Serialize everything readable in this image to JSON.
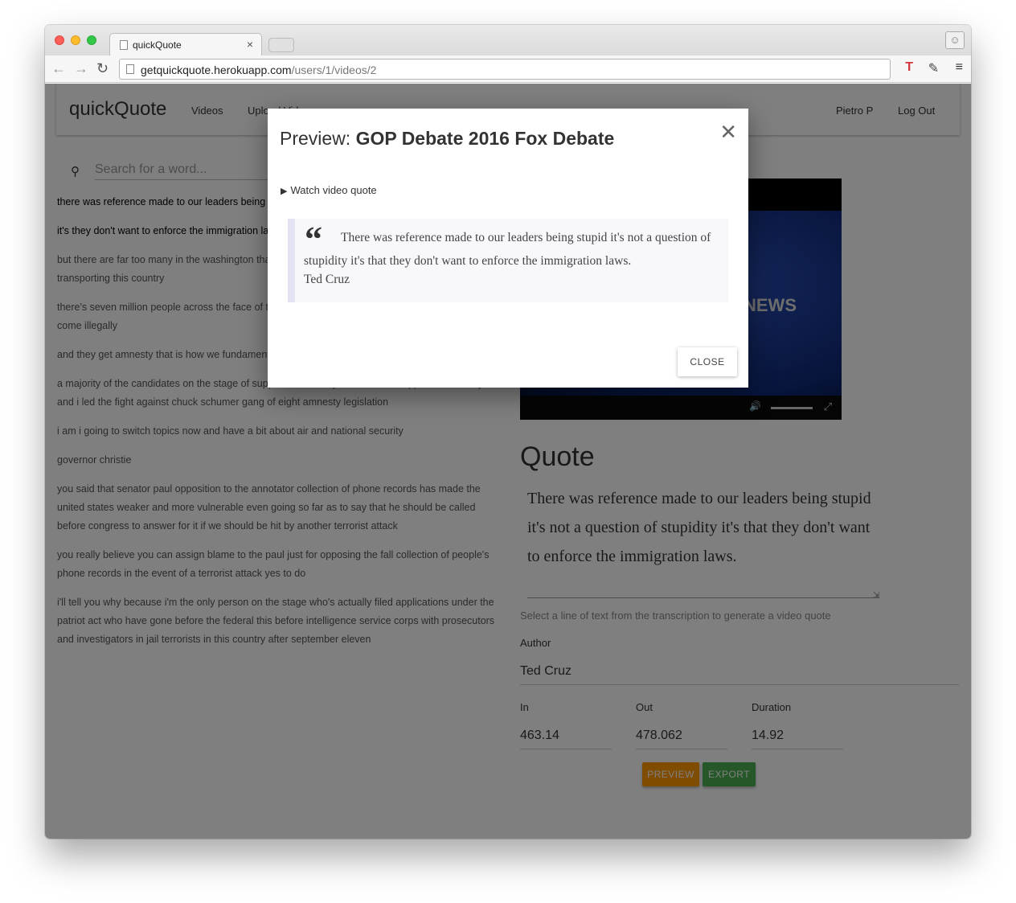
{
  "browser": {
    "tab_title": "quickQuote",
    "tab_close": "×",
    "url_domain": "getquickquote.herokuapp.com",
    "url_path": "/users/1/videos/2"
  },
  "app": {
    "brand": "quickQuote",
    "nav": {
      "videos": "Videos",
      "upload": "Upload Video",
      "user": "Pietro P",
      "logout": "Log Out"
    },
    "search_placeholder": "Search for a word..."
  },
  "transcript": [
    {
      "text": "there was reference made to our leaders being stupid it's not a question of stupidity",
      "highlighted": true
    },
    {
      "text": "it's they don't want to enforce the immigration laws",
      "highlighted": true
    },
    {
      "text": "but there are far too many in the washington that are not interested in talking about fundamentally transporting this country",
      "highlighted": false
    },
    {
      "text": "there's seven million people across the face of the country they come illegally great but if they come illegally",
      "highlighted": false
    },
    {
      "text": "and they get amnesty that is how we fundamentally transform this country it's striking",
      "highlighted": false
    },
    {
      "text": "a majority of the candidates on the stage of supported amnesty i have never supported amnesty and i led the fight against chuck schumer gang of eight amnesty legislation",
      "highlighted": false
    },
    {
      "text": "i am i going to switch topics now and have a bit about air and national security",
      "highlighted": false
    },
    {
      "text": "governor christie",
      "highlighted": false
    },
    {
      "text": "you said that senator paul opposition to the annotator collection of phone records has made the united states weaker and more vulnerable even going so far as to say that he should be called before congress to answer for it if we should be hit by another terrorist attack",
      "highlighted": false
    },
    {
      "text": "you really believe you can assign blame to the paul just for opposing the fall collection of people's phone records in the event of a terrorist attack yes to do",
      "highlighted": false
    },
    {
      "text": "i'll tell you why because i'm the only person on the stage who's actually filed applications under the patriot act who have gone before the federal this before intelligence service corps with prosecutors and investigators in jail terrorists in this country after september eleven",
      "highlighted": false
    }
  ],
  "editor": {
    "heading": "Quote",
    "quote_text": "There was reference made to our leaders being stupid it's not a question of stupidity it's that they don't want to enforce the immigration laws.",
    "hint": "Select a line of text from the transcription to generate a video quote",
    "author_label": "Author",
    "author_value": "Ted Cruz",
    "in_label": "In",
    "in_value": "463.14",
    "out_label": "Out",
    "out_value": "478.062",
    "duration_label": "Duration",
    "duration_value": "14.92",
    "preview_button": "PREVIEW",
    "export_button": "EXPORT",
    "video_logo": "FOX NEWS"
  },
  "modal": {
    "title_prefix": "Preview: ",
    "title_bold": "GOP Debate 2016 Fox Debate",
    "watch_label": "Watch video quote",
    "quote_text": "There was reference made to our leaders being stupid it's not a question of stupidity it's that they don't want to enforce the immigration laws.",
    "quote_author": "Ted Cruz",
    "close_button": "CLOSE"
  },
  "colors": {
    "preview_button": "#ff9800",
    "export_button": "#4caf50",
    "overlay": "rgba(0,0,0,0.5)"
  }
}
